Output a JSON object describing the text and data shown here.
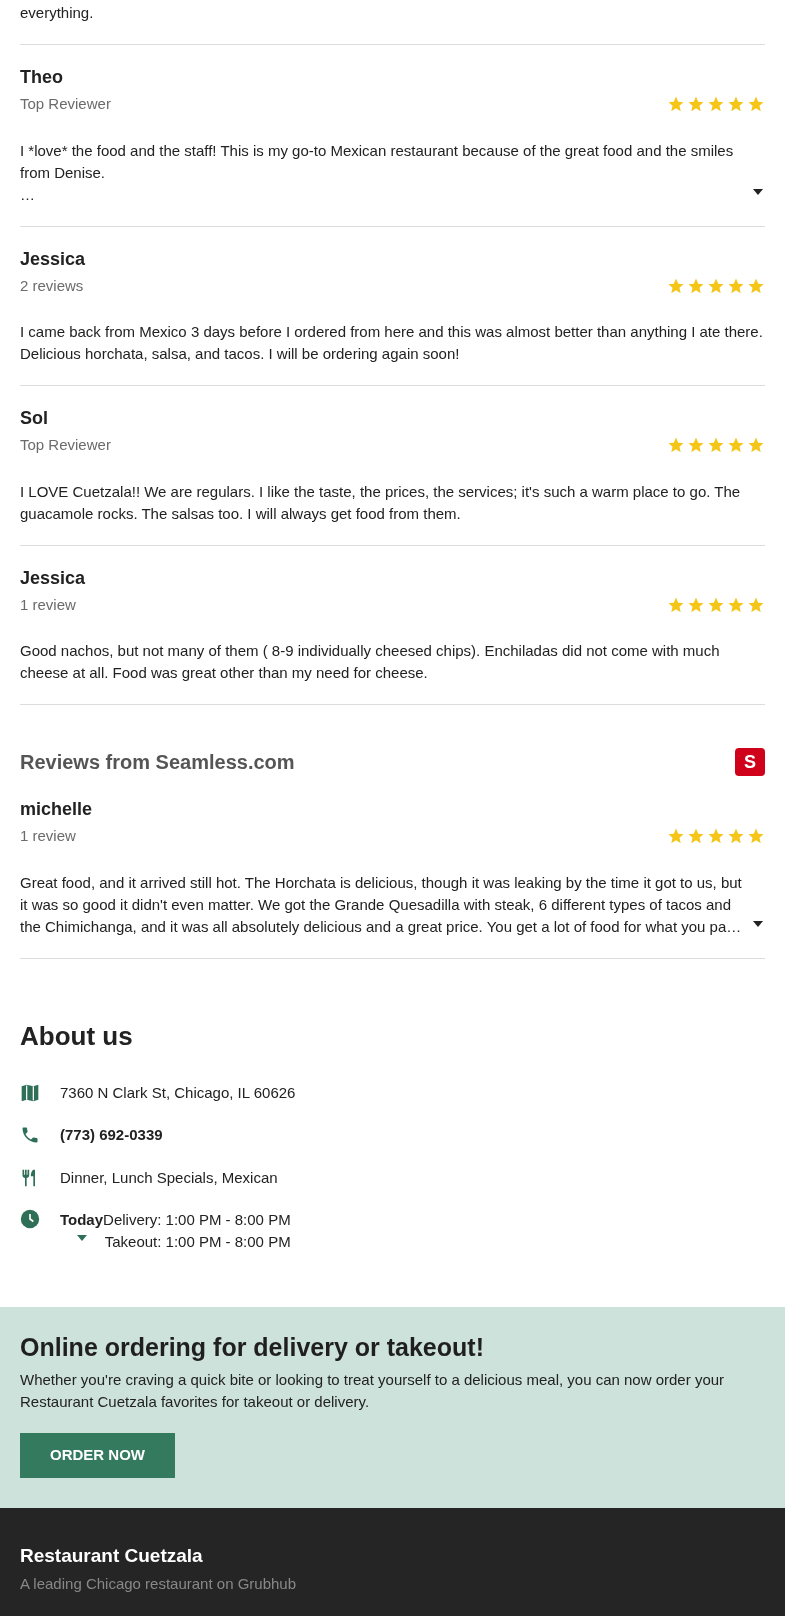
{
  "top_review_tail": "everything.",
  "reviews": [
    {
      "name": "Theo",
      "subtitle": "Top Reviewer",
      "stars": 5,
      "text": "I *love* the food and the staff! This is my go-to Mexican restaurant because of the great food and the smiles from Denise.",
      "more": "…",
      "expandable": true
    },
    {
      "name": "Jessica",
      "subtitle": "2 reviews",
      "stars": 5,
      "text": "I came back from Mexico 3 days before I ordered from here and this was almost better than anything I ate there. Delicious horchata, salsa, and tacos. I will be ordering again soon!",
      "expandable": false
    },
    {
      "name": "Sol",
      "subtitle": "Top Reviewer",
      "stars": 5,
      "text": "I LOVE Cuetzala!! We are regulars. I like the taste, the prices, the services; it's such a warm place to go. The guacamole rocks. The salsas too. I will always get food from them.",
      "expandable": false
    },
    {
      "name": "Jessica",
      "subtitle": "1 review",
      "stars": 5,
      "text": "Good nachos, but not many of them ( 8-9 individually cheesed chips). Enchiladas did not come with much cheese at all. Food was great other than my need for cheese.",
      "expandable": false
    }
  ],
  "seamless": {
    "title": "Reviews from Seamless.com",
    "logo_letter": "S",
    "reviews": [
      {
        "name": "michelle",
        "subtitle": "1 review",
        "stars": 5,
        "text": "Great food, and it arrived still hot. The Horchata is delicious, though it was leaking by the time it got to us, but it was so good it didn't even matter. We got the Grande Quesadilla with steak, 6 different types of tacos and the Chimichanga, and it was all absolutely delicious and a great price. You get a lot of food for what you pa…",
        "expandable": true
      }
    ]
  },
  "about": {
    "title": "About us",
    "items": [
      {
        "kind": "address",
        "text": "7360 N Clark St, Chicago, IL 60626"
      },
      {
        "kind": "phone",
        "text": "(773) 692-0339"
      },
      {
        "kind": "cuisine",
        "text": "Dinner, Lunch Specials, Mexican"
      }
    ],
    "hours": {
      "day": "Today",
      "lines": [
        "Delivery: 1:00 PM - 8:00 PM",
        "Takeout: 1:00 PM - 8:00 PM"
      ],
      "expanded": false
    }
  },
  "promo": {
    "title": "Online ordering for delivery or takeout!",
    "text": "Whether you're craving a quick bite or looking to treat yourself to a delicious meal, you can now order your Restaurant Cuetzala favorites for takeout or delivery.",
    "button": "ORDER NOW"
  },
  "footer": {
    "title": "Restaurant Cuetzala",
    "subtitle": "A leading Chicago restaurant on Grubhub"
  }
}
